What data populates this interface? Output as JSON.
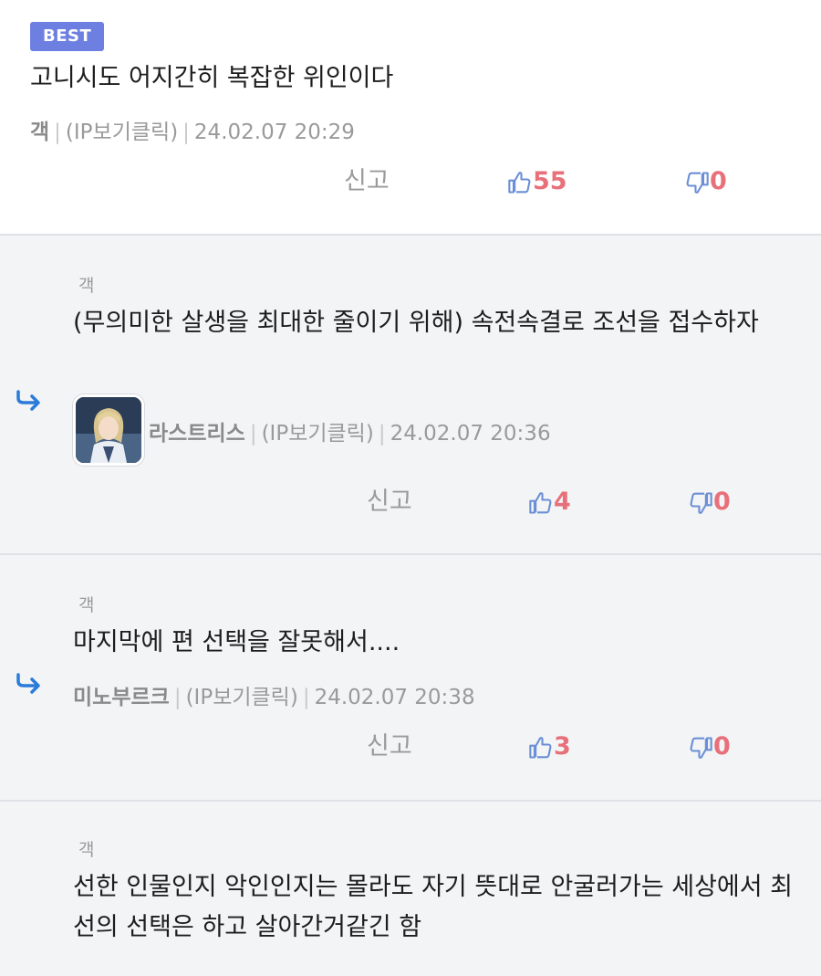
{
  "best_comment": {
    "badge": "BEST",
    "text": "고니시도 어지간히 복잡한 위인이다",
    "nick": "객",
    "ip": "(IP보기클릭)",
    "date": "24.02.07 20:29",
    "report_label": "신고",
    "upvotes": "55",
    "downvotes": "0"
  },
  "separator": "|",
  "replies": [
    {
      "parent_nick": "객",
      "text": "(무의미한 살생을 최대한 줄이기 위해) 속전속결로 조선을 접수하자",
      "nick": "라스트리스",
      "ip": "(IP보기클릭)",
      "date": "24.02.07 20:36",
      "report_label": "신고",
      "upvotes": "4",
      "downvotes": "0"
    },
    {
      "parent_nick": "객",
      "text": "마지막에 편 선택을 잘못해서....",
      "nick": "미노부르크",
      "ip": "(IP보기클릭)",
      "date": "24.02.07 20:38",
      "report_label": "신고",
      "upvotes": "3",
      "downvotes": "0"
    },
    {
      "parent_nick": "객",
      "text": "선한 인물인지 악인인지는 몰라도 자기 뜻대로 안굴러가는 세상에서 최선의 선택은 하고 살아간거같긴 함"
    }
  ],
  "colors": {
    "badge": "#6d7fe0",
    "vote_count": "#e8707a",
    "thumb_icon": "#6b8fd6",
    "reply_arrow": "#2b7bd9",
    "reply_background": "#f3f4f6"
  },
  "icons": {
    "thumbs_up": "thumbs-up-icon",
    "thumbs_down": "thumbs-down-icon",
    "reply_arrow": "reply-arrow-icon"
  }
}
